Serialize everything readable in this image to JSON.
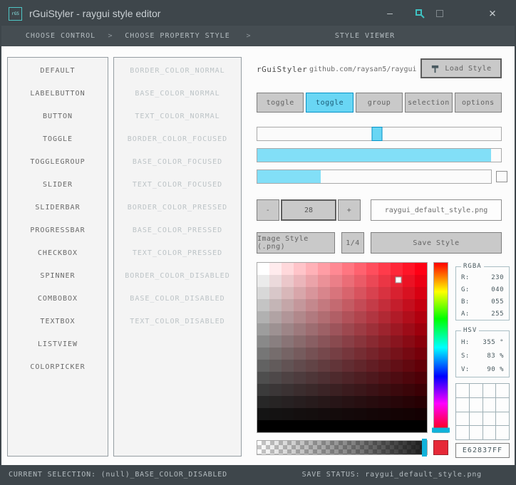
{
  "window": {
    "title": "rGuiStyler - raygui style editor",
    "logo": "rGS",
    "controls": {
      "minimize": "—",
      "close": "×"
    }
  },
  "breadcrumb": {
    "sections": [
      "CHOOSE CONTROL",
      "CHOOSE PROPERTY STYLE",
      "STYLE VIEWER"
    ],
    "separator": ">"
  },
  "controls_list": [
    "DEFAULT",
    "LABELBUTTON",
    "BUTTON",
    "TOGGLE",
    "TOGGLEGROUP",
    "SLIDER",
    "SLIDERBAR",
    "PROGRESSBAR",
    "CHECKBOX",
    "SPINNER",
    "COMBOBOX",
    "TEXTBOX",
    "LISTVIEW",
    "COLORPICKER"
  ],
  "properties_list": [
    "BORDER_COLOR_NORMAL",
    "BASE_COLOR_NORMAL",
    "TEXT_COLOR_NORMAL",
    "BORDER_COLOR_FOCUSED",
    "BASE_COLOR_FOCUSED",
    "TEXT_COLOR_FOCUSED",
    "BORDER_COLOR_PRESSED",
    "BASE_COLOR_PRESSED",
    "TEXT_COLOR_PRESSED",
    "BORDER_COLOR_DISABLED",
    "BASE_COLOR_DISABLED",
    "TEXT_COLOR_DISABLED"
  ],
  "viewer": {
    "app_name": "rGuiStyler",
    "repo_link": "github.com/raysan5/raygui",
    "load_style_button": "Load Style",
    "toggles": [
      "toggle",
      "toggle",
      "group",
      "selection",
      "options"
    ],
    "active_toggle_index": 1,
    "slider_percent": 49,
    "sliderbar_percent": 96,
    "progressbar_percent": 27,
    "spinner": {
      "minus": "-",
      "value": "28",
      "plus": "+"
    },
    "file_name_box": "raygui_default_style.png",
    "image_style_button": "Image Style (.png)",
    "ratio_button": "1/4",
    "save_style_button": "Save Style",
    "picker": {
      "hue": 355,
      "saturation": 0.83,
      "value": 0.9,
      "alpha": 1.0,
      "steps": 14
    },
    "rgba_box": {
      "title": "RGBA",
      "rows": [
        {
          "label": "R:",
          "value": "230"
        },
        {
          "label": "G:",
          "value": "040"
        },
        {
          "label": "B:",
          "value": "055"
        },
        {
          "label": "A:",
          "value": "255"
        }
      ]
    },
    "hsv_box": {
      "title": "HSV",
      "rows": [
        {
          "label": "H:",
          "value": "355 °"
        },
        {
          "label": "S:",
          "value": "83 %"
        },
        {
          "label": "V:",
          "value": "90 %"
        }
      ]
    },
    "hex_value": "E62837FF",
    "selected_color": "#E62837"
  },
  "statusbar": {
    "left": "CURRENT SELECTION: (null)_BASE_COLOR_DISABLED",
    "right": "SAVE STATUS: raygui_default_style.png"
  },
  "colors": {
    "titlebar_bg": "#3E464B",
    "accent_cyan": "#69D6F4",
    "accent_cyan_border": "#0492C7",
    "hue_marker_cyan": "#10B2DA",
    "button_bg": "#C9C9C9",
    "button_border": "#7E7E7E",
    "text_gray": "#686868",
    "disabled_text": "#BCC3C6",
    "selected_red": "#E62837",
    "logo_teal": "#4FC6C6"
  }
}
